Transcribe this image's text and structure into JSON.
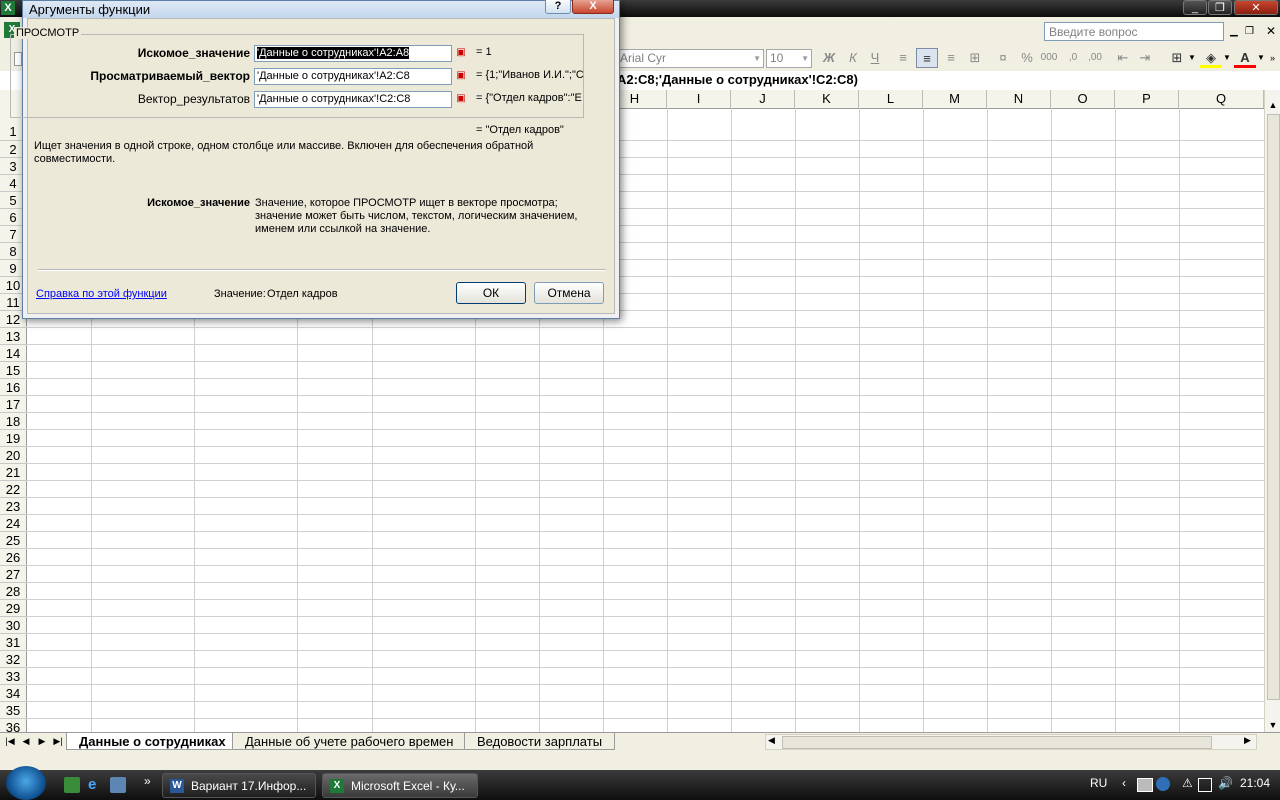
{
  "excel": {
    "app_icon": "X",
    "help_question_placeholder": "Введите вопрос",
    "font_name": "Arial Cyr",
    "font_size": "10",
    "formula_text": "A2:C8;'Данные о сотрудниках'!C2:C8)",
    "columns": [
      "H",
      "I",
      "J",
      "K",
      "L",
      "M",
      "N",
      "O",
      "P",
      "Q"
    ],
    "rows": [
      "1",
      "2",
      "3",
      "4",
      "5",
      "6",
      "7",
      "8",
      "9",
      "10",
      "11",
      "12",
      "13",
      "14",
      "15",
      "16",
      "17",
      "18",
      "19",
      "20",
      "21",
      "22",
      "23",
      "24",
      "25",
      "26",
      "27",
      "28",
      "29",
      "30",
      "31",
      "32",
      "33",
      "34",
      "35",
      "36"
    ],
    "sheet_tabs": [
      "Данные о сотрудниках",
      "Данные об учете рабочего времен",
      "Ведовости зарплаты"
    ],
    "active_tab": 0
  },
  "dialog": {
    "title": "Аргументы функции",
    "help_btn": "?",
    "close_btn": "X",
    "function_name": "ПРОСМОТР",
    "args": [
      {
        "label": "Искомое_значение",
        "value": "'Данные о сотрудниках'!A2:A8",
        "result": "= 1",
        "bold": true
      },
      {
        "label": "Просматриваемый_вектор",
        "value": "'Данные о сотрудниках'!A2:C8",
        "result": "= {1;\"Иванов И.И.\";\"С",
        "bold": true
      },
      {
        "label": "Вектор_результатов",
        "value": "'Данные о сотрудниках'!C2:C8",
        "result": "= {\"Отдел кадров\":\"Е",
        "bold": false
      }
    ],
    "formula_result": "= \"Отдел кадров\"",
    "description": "Ищет значения в одной строке, одном столбце или массиве. Включен для обеспечения обратной совместимости.",
    "arg_help_label": "Искомое_значение",
    "arg_help_text": "Значение, которое ПРОСМОТР ищет в векторе просмотра; значение может быть числом, текстом, логическим значением, именем или ссылкой на значение.",
    "help_link": "Справка по этой функции",
    "value_label": "Значение:",
    "value": "Отдел кадров",
    "ok": "ОК",
    "cancel": "Отмена"
  },
  "taskbar": {
    "buttons": [
      "Вариант 17.Инфор...",
      "Microsoft Excel - Ку..."
    ],
    "lang": "RU",
    "clock": "21:04"
  }
}
